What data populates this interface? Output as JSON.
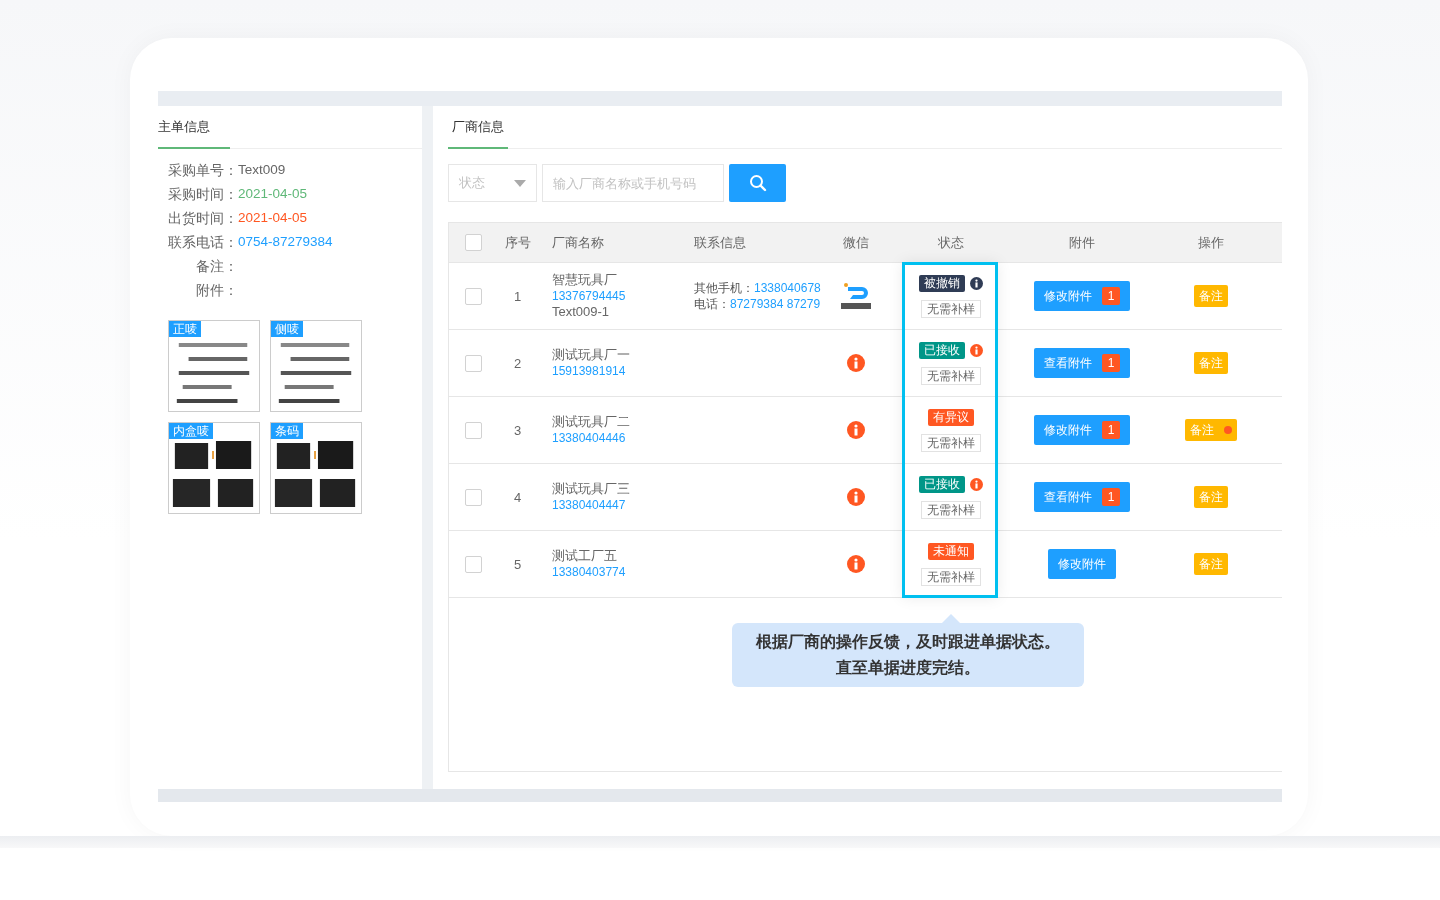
{
  "left_panel": {
    "tab": "主单信息",
    "fields": [
      {
        "label": "采购单号：",
        "value": "Text009",
        "color": "#666666"
      },
      {
        "label": "采购时间：",
        "value": "2021-04-05",
        "color": "#5fb878"
      },
      {
        "label": "出货时间：",
        "value": "2021-04-05",
        "color": "#ff5722"
      },
      {
        "label": "联系电话：",
        "value": "0754-87279384",
        "color": "#1e9fff"
      },
      {
        "label": "备注："
      },
      {
        "label": "附件："
      }
    ],
    "attachments": [
      {
        "tag": "正唛",
        "kind": "picture"
      },
      {
        "tag": "侧唛",
        "kind": "picture"
      },
      {
        "tag": "内盒唛",
        "kind": "picture"
      },
      {
        "tag": "条码",
        "kind": "picture"
      }
    ]
  },
  "right_panel": {
    "tab": "厂商信息",
    "filter": {
      "status_placeholder": "状态",
      "search_placeholder": "输入厂商名称或手机号码"
    },
    "table": {
      "select_all": {
        "checked": false
      },
      "columns": [
        "序号",
        "厂商名称",
        "联系信息",
        "微信",
        "状态",
        "附件",
        "操作"
      ],
      "rows": [
        {
          "checked": false,
          "index": "1",
          "name": "智慧玩具厂",
          "phone": "13376794445",
          "note": "Text009-1",
          "contact": [
            {
              "label": "其他手机：",
              "value": "1338040678"
            },
            {
              "label": "电话：",
              "value": "87279384 87279"
            }
          ],
          "wechat": {
            "kind": "logo"
          },
          "status": {
            "label": "被撤销",
            "color": "#2f3c55",
            "info": {
              "color": "#2f3c55"
            }
          },
          "sample": "无需补样",
          "attach": {
            "label": "修改附件",
            "count": "1"
          },
          "remark": {
            "label": "备注",
            "flagged": false
          }
        },
        {
          "checked": false,
          "index": "2",
          "name": "测试玩具厂一",
          "phone": "15913981914",
          "wechat": {
            "kind": "info"
          },
          "status": {
            "label": "已接收",
            "color": "#009688",
            "info": {
              "color": "#ff5722"
            }
          },
          "sample": "无需补样",
          "attach": {
            "label": "查看附件",
            "count": "1"
          },
          "remark": {
            "label": "备注",
            "flagged": false
          }
        },
        {
          "checked": false,
          "index": "3",
          "name": "测试玩具厂二",
          "phone": "13380404446",
          "wechat": {
            "kind": "info"
          },
          "status": {
            "label": "有异议",
            "color": "#ff5722"
          },
          "sample": "无需补样",
          "attach": {
            "label": "修改附件",
            "count": "1"
          },
          "remark": {
            "label": "备注",
            "flagged": true
          }
        },
        {
          "checked": false,
          "index": "4",
          "name": "测试玩具厂三",
          "phone": "13380404447",
          "wechat": {
            "kind": "info"
          },
          "status": {
            "label": "已接收",
            "color": "#009688",
            "info": {
              "color": "#ff5722"
            }
          },
          "sample": "无需补样",
          "attach": {
            "label": "查看附件",
            "count": "1"
          },
          "remark": {
            "label": "备注",
            "flagged": false
          }
        },
        {
          "checked": false,
          "index": "5",
          "name": "测试工厂五",
          "phone": "13380403774",
          "wechat": {
            "kind": "info"
          },
          "status": {
            "label": "未通知",
            "color": "#ff5722"
          },
          "sample": "无需补样",
          "attach": {
            "label": "修改附件"
          },
          "remark": {
            "label": "备注",
            "flagged": false
          }
        }
      ]
    },
    "tooltip": {
      "lines": [
        "根据厂商的操作反馈，及时跟进单据状态。",
        "直至单据进度完结。"
      ]
    }
  }
}
